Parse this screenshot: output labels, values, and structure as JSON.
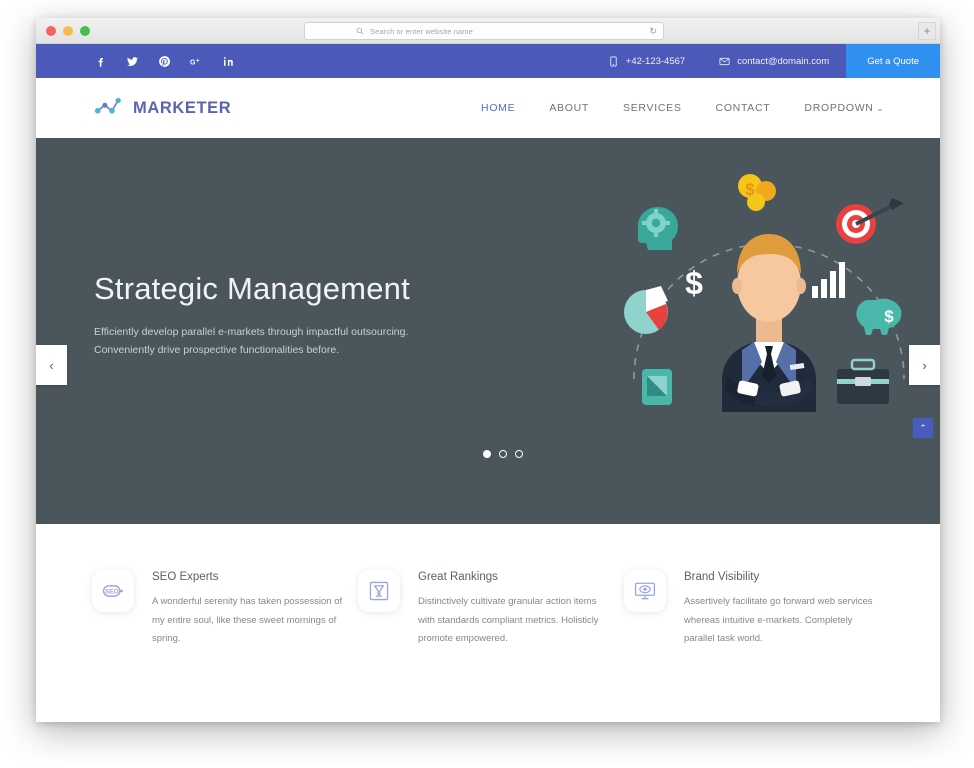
{
  "browser": {
    "search": {
      "placeholder": "Search or enter website name",
      "icon": "search-icon",
      "reload_icon": "reload-icon"
    },
    "new_tab_label": "+",
    "traffic_lights": [
      "close",
      "minimize",
      "zoom"
    ]
  },
  "topbar": {
    "socials": [
      {
        "name": "facebook-icon",
        "label": "f"
      },
      {
        "name": "twitter-icon",
        "label": "Twitter"
      },
      {
        "name": "pinterest-icon",
        "label": "P"
      },
      {
        "name": "google-plus-icon",
        "label": "G+"
      },
      {
        "name": "linkedin-icon",
        "label": "in"
      }
    ],
    "phone": "+42-123-4567",
    "phone_icon": "phone-icon",
    "email": "contact@domain.com",
    "email_icon": "envelope-icon",
    "quote_label": "Get a Quote",
    "bg_color": "#4b5ab8",
    "quote_color": "#2f90ef"
  },
  "nav": {
    "brand": "MARKETER",
    "brand_icon": "network-nodes-icon",
    "brand_color": "#5b63b0",
    "links": [
      {
        "label": "HOME",
        "active": true
      },
      {
        "label": "ABOUT",
        "active": false
      },
      {
        "label": "SERVICES",
        "active": false
      },
      {
        "label": "CONTACT",
        "active": false
      },
      {
        "label": "DROPDOWN",
        "active": false,
        "caret": "⌄"
      }
    ]
  },
  "hero": {
    "title": "Strategic Management",
    "subtitle_line1": "Efficiently develop parallel e-markets through impactful outsourcing.",
    "subtitle_line2": "Conveniently drive prospective functionalities before.",
    "bg_color": "#4a565b",
    "prev_label": "‹",
    "next_label": "›",
    "scroll_top_label": "⌃",
    "slides_total": 3,
    "slide_active": 1,
    "illustration": {
      "name": "businessman-marketing-illustration",
      "elements": [
        "brain-gear-head-icon",
        "idea-money-bulb-icon",
        "target-dart-icon",
        "piggy-bank-icon",
        "briefcase-icon",
        "bar-chart-icon",
        "dollar-sign-icon",
        "pie-chart-icon",
        "businessman-figure"
      ]
    }
  },
  "features": [
    {
      "icon": "seo-badge-icon",
      "title": "SEO Experts",
      "text": "A wonderful serenity has taken possession of my entire soul, like these sweet mornings of spring."
    },
    {
      "icon": "trophy-icon",
      "title": "Great Rankings",
      "text": "Distinctively cultivate granular action items with standards compliant metrics. Holisticly promote empowered."
    },
    {
      "icon": "monitor-eye-icon",
      "title": "Brand Visibility",
      "text": "Assertively facilitate go forward web services whereas intuitive e-markets. Completely parallel task world."
    }
  ]
}
